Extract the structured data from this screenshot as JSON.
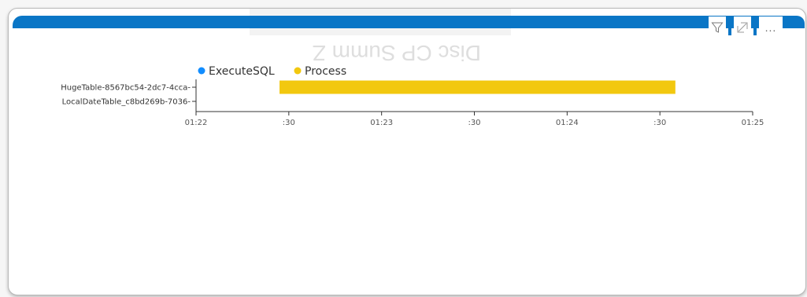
{
  "visual": {
    "title": "",
    "ghost_text": "Disc CP Summ Z",
    "header_icons": [
      "filter-icon",
      "focus-mode-icon",
      "more-options-icon"
    ],
    "more_options_label": "..."
  },
  "chart_data": {
    "type": "bar",
    "orientation": "horizontal-timeline",
    "categories": [
      "HugeTable-8567bc54-2dc7-4cca-",
      "LocalDateTable_c8bd269b-7036-"
    ],
    "x_ticks": [
      "01:22",
      ":30",
      "01:23",
      ":30",
      "01:24",
      ":30",
      "01:25"
    ],
    "x_range_seconds": [
      0,
      180
    ],
    "legend": {
      "position": "top",
      "items": [
        {
          "name": "ExecuteSQL",
          "color": "#118dff"
        },
        {
          "name": "Process",
          "color": "#f2c80f"
        }
      ]
    },
    "series": [
      {
        "name": "ExecuteSQL",
        "color": "#118dff",
        "bars": []
      },
      {
        "name": "Process",
        "color": "#f2c80f",
        "bars": [
          {
            "category": "HugeTable-8567bc54-2dc7-4cca-",
            "start": 27,
            "end": 155
          }
        ]
      }
    ]
  }
}
